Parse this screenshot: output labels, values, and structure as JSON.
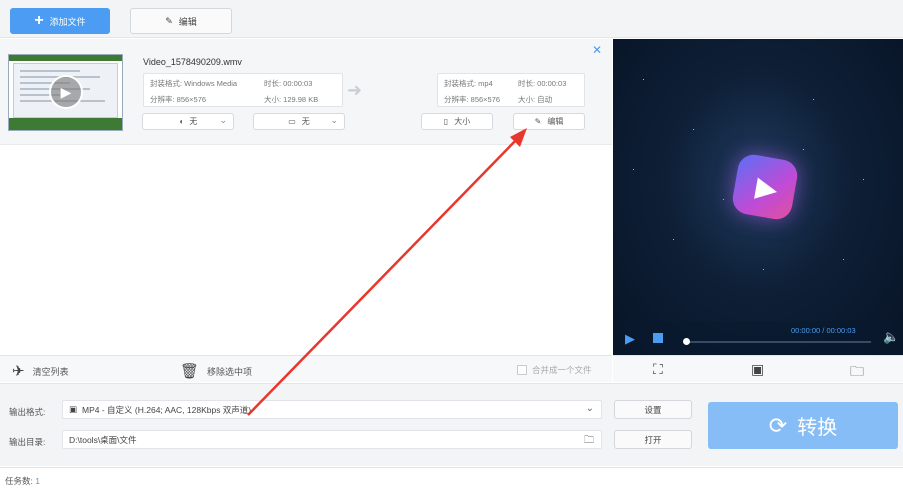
{
  "toolbar": {
    "add_file_label": "添加文件",
    "edit_label": "编辑"
  },
  "file": {
    "name": "Video_1578490209.wmv",
    "source": {
      "format_label": "封装格式: Windows Media",
      "duration_label": "时长: 00:00:03",
      "resolution_label": "分辨率: 856×576",
      "size_label": "大小: 129.98 KB"
    },
    "target": {
      "format_label": "封装格式: mp4",
      "duration_label": "时长: 00:00:03",
      "resolution_label": "分辨率: 856×576",
      "size_label": "大小: 自动"
    },
    "audio_select": "无",
    "subtitle_select": "无",
    "size_button": "大小",
    "edit_button": "编辑"
  },
  "list_actions": {
    "clear_label": "清空列表",
    "remove_label": "移除选中项",
    "merge_label": "合并成一个文件"
  },
  "preview": {
    "time": "00:00:00 / 00:00:03",
    "progress": 0
  },
  "output": {
    "format_label": "输出格式:",
    "format_value": "MP4 - 自定义 (H.264; AAC, 128Kbps 双声道)",
    "dir_label": "输出目录:",
    "dir_value": "D:\\tools\\桌面\\文件",
    "settings_button": "设置",
    "open_button": "打开",
    "convert_button": "转换"
  },
  "status": {
    "tasks_label": "任务数:",
    "tasks_count": "1"
  },
  "colors": {
    "accent": "#4b9cf2",
    "convert": "#86bdf6",
    "annotation_arrow": "#e8372c"
  }
}
